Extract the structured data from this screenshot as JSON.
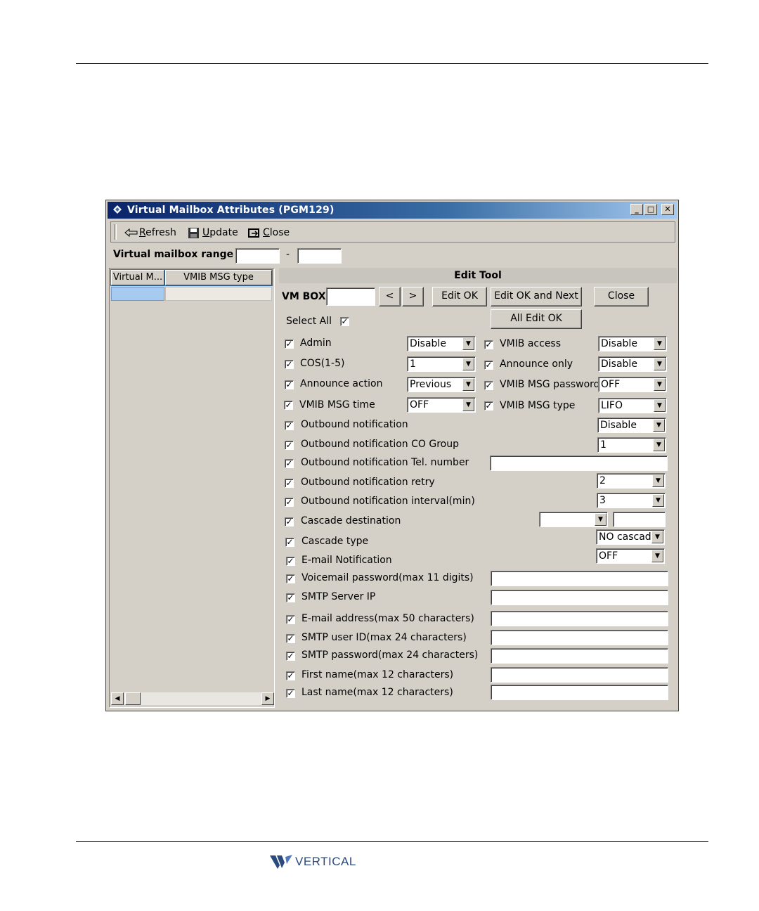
{
  "window": {
    "title": "Virtual Mailbox Attributes (PGM129)",
    "min_label": "_",
    "max_label": "□",
    "close_label": "✕"
  },
  "toolbar": {
    "refresh": {
      "key": "R",
      "rest": "efresh"
    },
    "update": {
      "key": "U",
      "rest": "pdate"
    },
    "close": {
      "key": "C",
      "rest": "lose"
    }
  },
  "range": {
    "label": "Virtual mailbox range",
    "from": "",
    "to": "",
    "separator": "-"
  },
  "list": {
    "headers": [
      "Virtual M...",
      "VMIB MSG type"
    ]
  },
  "edit": {
    "heading": "Edit Tool",
    "vmbox_label": "VM BOX",
    "vmbox_value": "",
    "prev": "<",
    "next": ">",
    "edit_ok": "Edit OK",
    "edit_ok_next": "Edit OK and Next",
    "close": "Close",
    "all_edit_ok": "All Edit OK",
    "select_all": "Select All"
  },
  "left_fields": [
    {
      "label": "Admin",
      "value": "Disable"
    },
    {
      "label": "COS(1-5)",
      "value": "1"
    },
    {
      "label": "Announce action",
      "value": "Previous"
    },
    {
      "label": "VMIB MSG time",
      "value": "OFF"
    }
  ],
  "right_fields": [
    {
      "label": "VMIB access",
      "value": "Disable"
    },
    {
      "label": "Announce only",
      "value": "Disable"
    },
    {
      "label": "VMIB MSG password",
      "value": "OFF"
    },
    {
      "label": "VMIB MSG type",
      "value": "LIFO"
    }
  ],
  "rows": [
    {
      "label": "Outbound notification",
      "value": "Disable"
    },
    {
      "label": "Outbound notification CO Group",
      "value": "1"
    },
    {
      "label": "Outbound notification Tel. number",
      "value": ""
    },
    {
      "label": "Outbound notification retry",
      "value": "2"
    },
    {
      "label": "Outbound notification interval(min)",
      "value": "3"
    },
    {
      "label": "Cascade destination",
      "value": "",
      "value2": ""
    },
    {
      "label": "Cascade type",
      "value": "NO cascadi"
    },
    {
      "label": "E-mail Notification",
      "value": "OFF"
    },
    {
      "label": "Voicemail password(max 11 digits)",
      "value": ""
    },
    {
      "label": "SMTP Server IP",
      "value": ""
    },
    {
      "label": "E-mail address(max 50 characters)",
      "value": ""
    },
    {
      "label": "SMTP user ID(max 24 characters)",
      "value": ""
    },
    {
      "label": "SMTP password(max 24 characters)",
      "value": ""
    },
    {
      "label": "First name(max 12 characters)",
      "value": ""
    },
    {
      "label": "Last name(max 12 characters)",
      "value": ""
    }
  ],
  "footer": {
    "brand": "VERTICAL"
  },
  "colors": {
    "title_start": "#0a246a",
    "title_end": "#a6caf0",
    "face": "#d4d0c8",
    "logo": "#2b4a7e"
  },
  "icons": [
    "refresh-arrow-icon",
    "update-floppy-icon",
    "close-door-icon",
    "window-diamond-icon",
    "checkmark-icon",
    "dropdown-arrow-icon"
  ]
}
